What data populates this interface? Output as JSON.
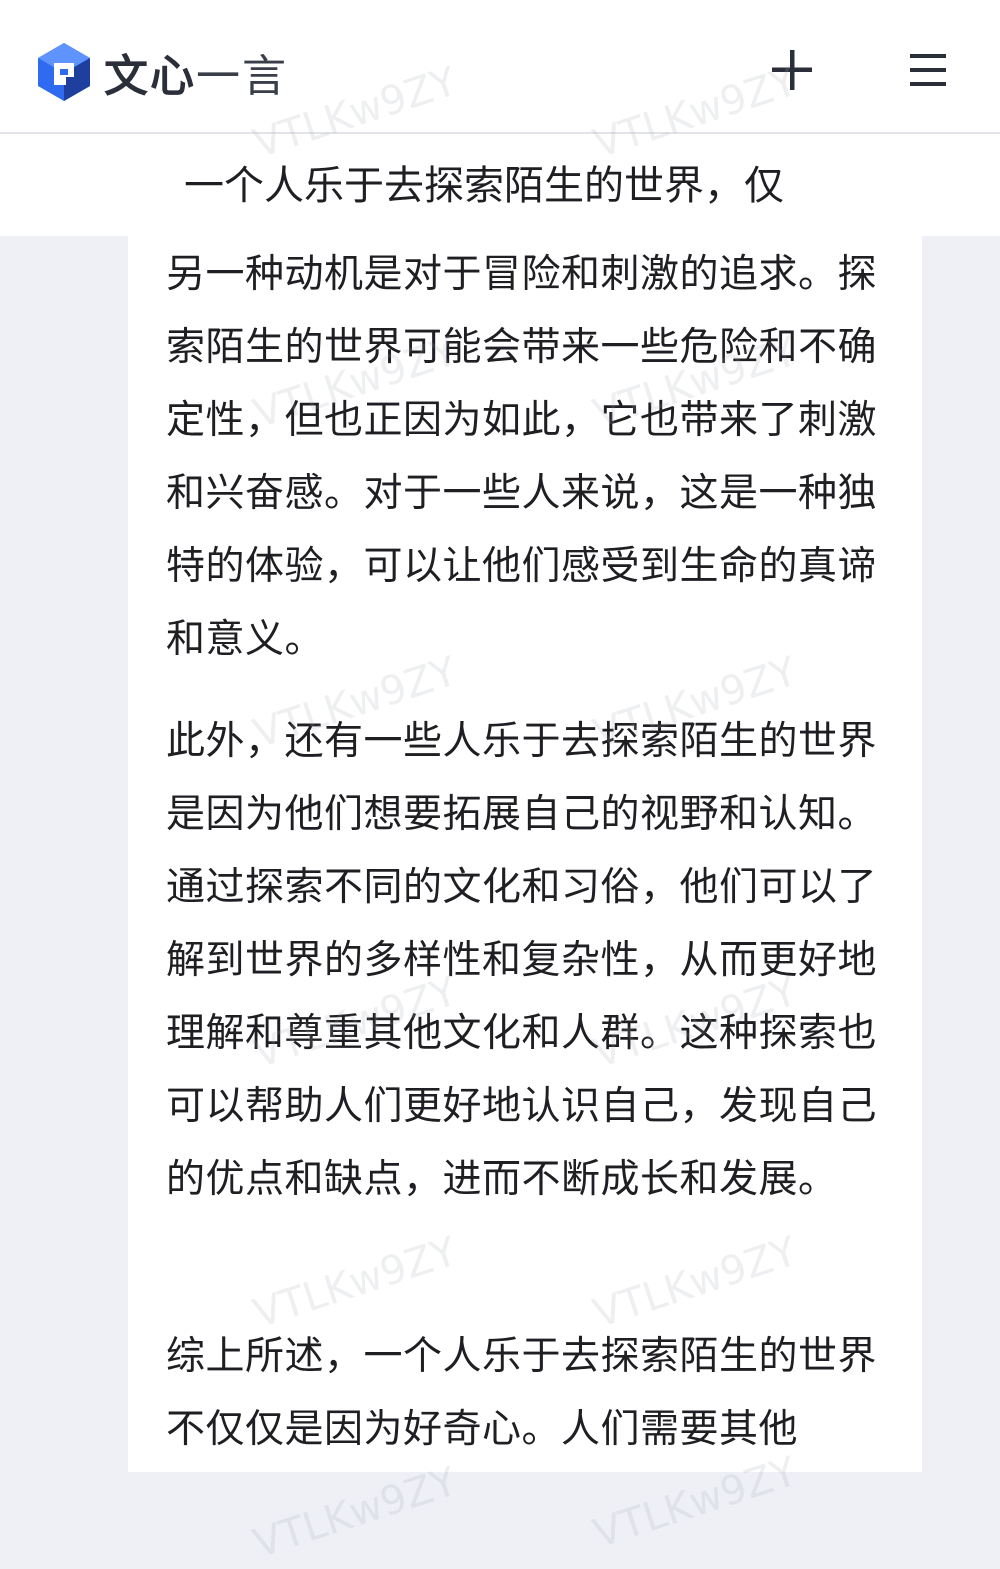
{
  "header": {
    "app_name_bold": "文心",
    "app_name_rest": "一言",
    "logo_icon": "wenxin-logo-icon",
    "new_chat_icon": "plus-icon",
    "menu_icon": "hamburger-menu-icon"
  },
  "colors": {
    "logo_blue": "#2f6bf0",
    "logo_dark": "#1f3f9e",
    "background": "#eef0f6"
  },
  "conversation": {
    "prompt_line": "一个人乐于去探索陌生的世界，仅",
    "paragraphs": [
      "另一种动机是对于冒险和刺激的追求。探索陌生的世界可能会带来一些危险和不确定性，但也正因为如此，它也带来了刺激和兴奋感。对于一些人来说，这是一种独特的体验，可以让他们感受到生命的真谛和意义。",
      "此外，还有一些人乐于去探索陌生的世界是因为他们想要拓展自己的视野和认知。通过探索不同的文化和习俗，他们可以了解到世界的多样性和复杂性，从而更好地理解和尊重其他文化和人群。这种探索也可以帮助人们更好地认识自己，发现自己的优点和缺点，进而不断成长和发展。",
      "综上所述，一个人乐于去探索陌生的世界不仅仅是因为好奇心。人们需要其他"
    ]
  },
  "watermark": "VTLKw9ZY"
}
